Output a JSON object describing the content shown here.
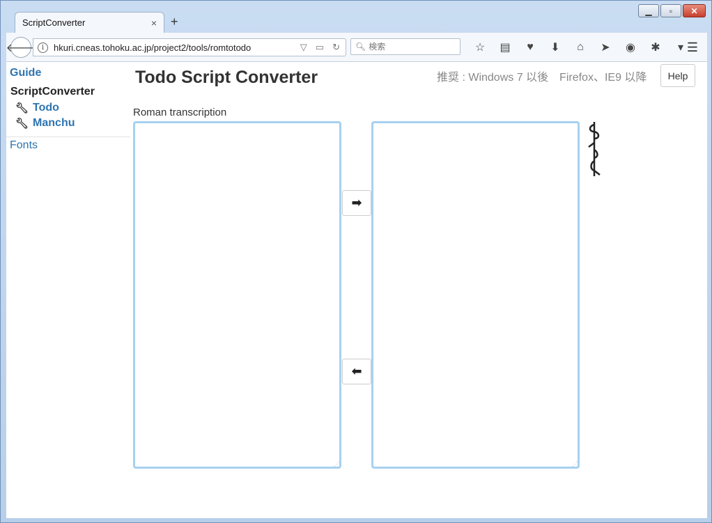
{
  "browser": {
    "tab_title": "ScriptConverter",
    "tab_close": "×",
    "new_tab": "+",
    "url": "hkuri.cneas.tohoku.ac.jp/project2/tools/romtotodo",
    "search_placeholder": "検索",
    "window_controls": [
      "minimize",
      "maximize",
      "close"
    ]
  },
  "sidebar": {
    "guide": "Guide",
    "section": "ScriptConverter",
    "items": [
      {
        "label": "Todo",
        "icon": "wrench-icon"
      },
      {
        "label": "Manchu",
        "icon": "wrench-icon"
      }
    ],
    "fonts": "Fonts"
  },
  "main": {
    "title": "Todo Script Converter",
    "recommend_os": "推奨 : Windows 7 以後",
    "recommend_browser": "Firefox、IE9 以降",
    "help_label": "Help",
    "input_label": "Roman transcription",
    "convert_right": "➡",
    "convert_left": "⬅",
    "script_sample": "ᡨᠣᡩᠣ"
  },
  "colors": {
    "link": "#2d75b0",
    "textarea_border": "#a6d1f0",
    "title_text": "#333333"
  }
}
